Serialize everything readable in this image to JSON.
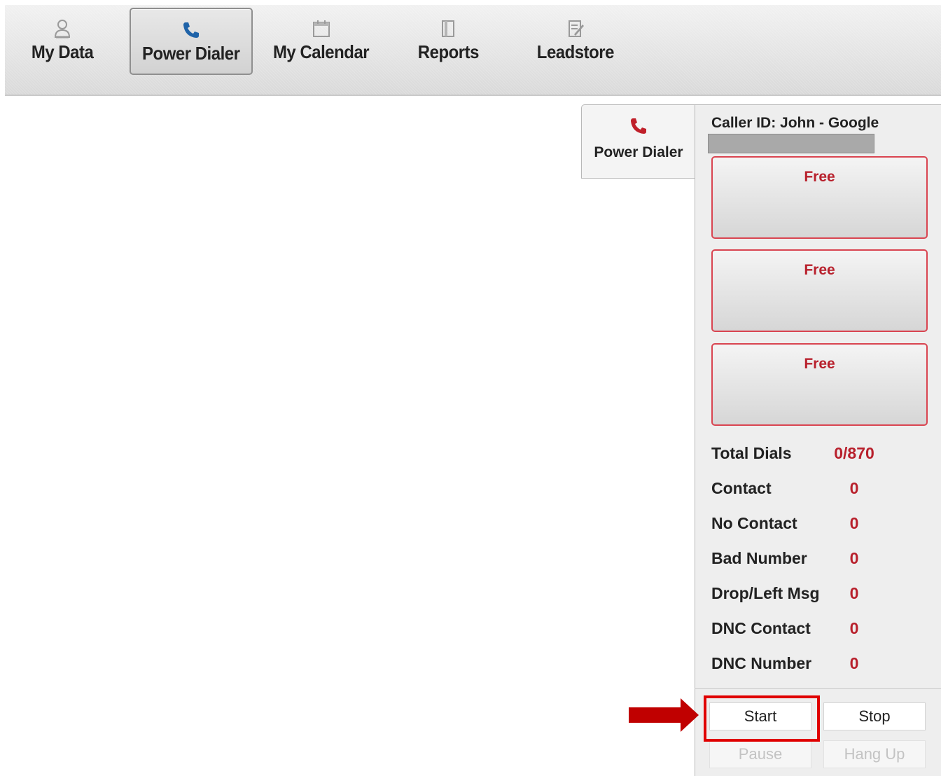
{
  "nav": {
    "items": [
      {
        "label": "My Data",
        "icon": "user-icon"
      },
      {
        "label": "Power Dialer",
        "icon": "phone-icon",
        "active": true
      },
      {
        "label": "My Calendar",
        "icon": "calendar-icon"
      },
      {
        "label": "Reports",
        "icon": "report-icon"
      },
      {
        "label": "Leadstore",
        "icon": "leadstore-icon"
      }
    ]
  },
  "dialer": {
    "tab_label": "Power Dialer",
    "caller_id": "Caller ID: John - Google",
    "lines": [
      {
        "status": "Free"
      },
      {
        "status": "Free"
      },
      {
        "status": "Free"
      }
    ],
    "stats": [
      {
        "label": "Total Dials",
        "value": "0/870"
      },
      {
        "label": "Contact",
        "value": "0"
      },
      {
        "label": "No Contact",
        "value": "0"
      },
      {
        "label": "Bad Number",
        "value": "0"
      },
      {
        "label": "Drop/Left Msg",
        "value": "0"
      },
      {
        "label": "DNC Contact",
        "value": "0"
      },
      {
        "label": "DNC Number",
        "value": "0"
      }
    ],
    "buttons": {
      "start": "Start",
      "stop": "Stop",
      "pause": "Pause",
      "hang_up": "Hang Up"
    }
  },
  "colors": {
    "accent_red": "#b8202c",
    "line_border": "#d94450",
    "phone_blue": "#1f63a8",
    "highlight": "#e00000"
  }
}
